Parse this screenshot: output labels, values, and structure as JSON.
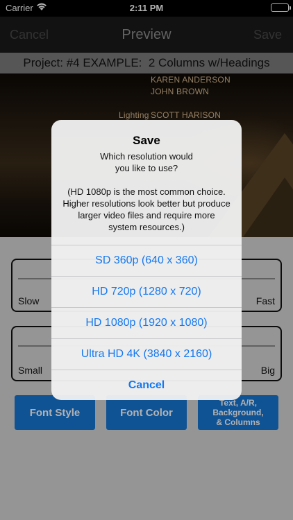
{
  "status_bar": {
    "carrier": "Carrier",
    "time": "2:11 PM",
    "wifi_icon": "wifi-icon",
    "battery_icon": "battery-icon"
  },
  "nav": {
    "cancel_label": "Cancel",
    "title": "Preview",
    "save_label": "Save"
  },
  "project_label": "Project: #4 EXAMPLE:  2 Columns w/Headings",
  "preview": {
    "credit_lines": [
      "KAREN ANDERSON",
      "JOHN BROWN"
    ],
    "role": "Lighting",
    "role_name": "SCOTT HARISON"
  },
  "controls": {
    "speed": {
      "min_label": "Slow",
      "max_label": "Fast"
    },
    "size": {
      "min_label": "Small",
      "max_label": "Big"
    },
    "buttons": {
      "font_style": "Font Style",
      "font_color": "Font Color",
      "text_settings": "Text, A/R,\nBackground,\n& Columns"
    }
  },
  "alert": {
    "title": "Save",
    "message": "Which resolution would\nyou like to use?\n\n(HD 1080p is the most common choice.  Higher resolutions look better but produce larger video files and require more system resources.)",
    "options": [
      "SD 360p (640 x 360)",
      "HD 720p (1280 x 720)",
      "HD 1080p (1920 x 1080)",
      "Ultra HD 4K (3840 x 2160)"
    ],
    "cancel_label": "Cancel"
  },
  "colors": {
    "accent_blue": "#1478f0",
    "button_blue": "#1878d4",
    "nav_bg": "#1a1a1a"
  }
}
